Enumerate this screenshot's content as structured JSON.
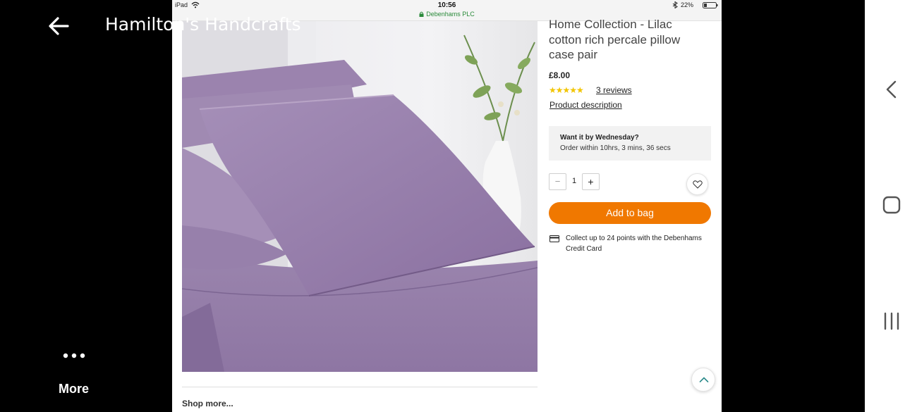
{
  "viewer": {
    "title": "Hamilton's Handcrafts",
    "more_label": "More",
    "icons": [
      "arrow-left-icon",
      "more-dots-icon"
    ]
  },
  "android_nav": {
    "icons": [
      "nav-back-icon",
      "nav-home-icon",
      "nav-recent-apps-icon"
    ]
  },
  "status_bar": {
    "device": "iPad",
    "time": "10:56",
    "url": "Debenhams PLC",
    "battery": "22%"
  },
  "product": {
    "title": "Home Collection - Lilac cotton rich percale pillow case pair",
    "price": "£8.00",
    "rating_stars": "★★★★★",
    "rating_value": 5,
    "reviews_link": "3 reviews",
    "description_link": "Product description",
    "delivery_heading": "Want it by Wednesday?",
    "delivery_countdown": "Order within 10hrs, 3 mins, 36 secs",
    "qty_minus": "−",
    "quantity": "1",
    "qty_plus": "+",
    "add_to_bag": "Add to bag",
    "points_text": "Collect up to 24 points with the Debenhams Credit Card",
    "shop_more": "Shop more..."
  },
  "colors": {
    "accent": "#f07800",
    "star": "#f2c500",
    "url_green": "#2a8a3a",
    "product_lilac": "#9b81ae"
  }
}
